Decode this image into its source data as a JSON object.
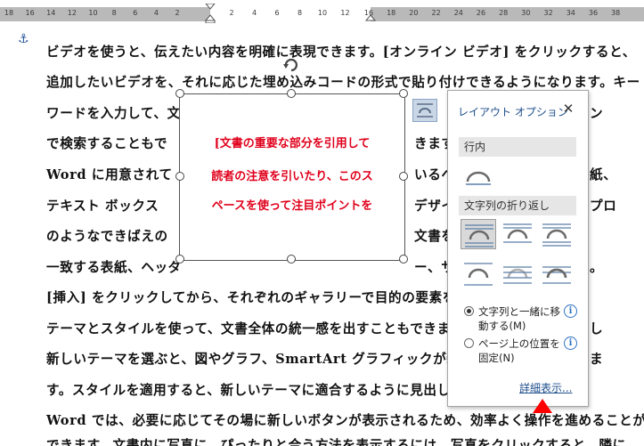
{
  "ruler": {
    "left_labels": [
      "18",
      "16",
      "14",
      "12",
      "10",
      "8",
      "6",
      "4",
      "2"
    ],
    "right_labels": [
      "2",
      "4",
      "6",
      "8",
      "10",
      "12",
      "16",
      "18",
      "20",
      "22",
      "24",
      "26",
      "28",
      "30",
      "32",
      "34",
      "36",
      "38"
    ]
  },
  "document": {
    "lines": [
      "ビデオを使うと、伝えたい内容を明確に表現できます。[オンライン ビデオ] をクリックすると、",
      "追加したいビデオを、それに応じた埋め込みコードの形式で貼り付けできるようになります。キー"
    ],
    "wrapped_left": [
      "ワードを入力して、文",
      "で検索することもで",
      "Word に用意されて",
      "テキスト ボックス",
      "のようなできばえの",
      "一致する表紙、ヘッダ"
    ],
    "wrapped_right": [
      "ン",
      "きます",
      "いるヘ",
      "デザイ",
      "文書を",
      "ー、サ"
    ],
    "right_edge": [
      "紙、",
      "プロ",
      "",
      "。"
    ],
    "lines_below": [
      "[挿入] をクリックしてから、それぞれのギャラリーで目的の要素を選",
      "テーマとスタイルを使って、文書全体の統一感を出すこともできます。",
      "新しいテーマを選ぶと、図やグラフ、SmartArt グラフィックが新しい",
      "す。スタイルを適用すると、新しいテーマに適合するように見出しが変",
      "Word では、必要に応じてその場に新しいボタンが表示されるため、効率よく操作を進めることが",
      "できます。文書内に写真に、ぴったりと合う方法を表示するには、写真をクリックすると、隣に"
    ],
    "right_tail": [
      "し",
      "ま"
    ]
  },
  "textbox": {
    "lines": [
      "[文書の重要な部分を引用して",
      "読者の注意を引いたり、このス",
      "ペースを使って注目ポイントを"
    ]
  },
  "panel": {
    "title": "レイアウト オプション",
    "close": "✕",
    "section_inline": "行内",
    "section_wrap": "文字列の折り返し",
    "radio1": "文字列と一緒に移動する(M)",
    "radio2": "ページ上の位置を固定(N)",
    "info": "i",
    "detail": "詳細表示..."
  },
  "colors": {
    "accent": "#1e4e8c",
    "textbox_text": "#e0001b",
    "pointer": "#ff0000"
  }
}
